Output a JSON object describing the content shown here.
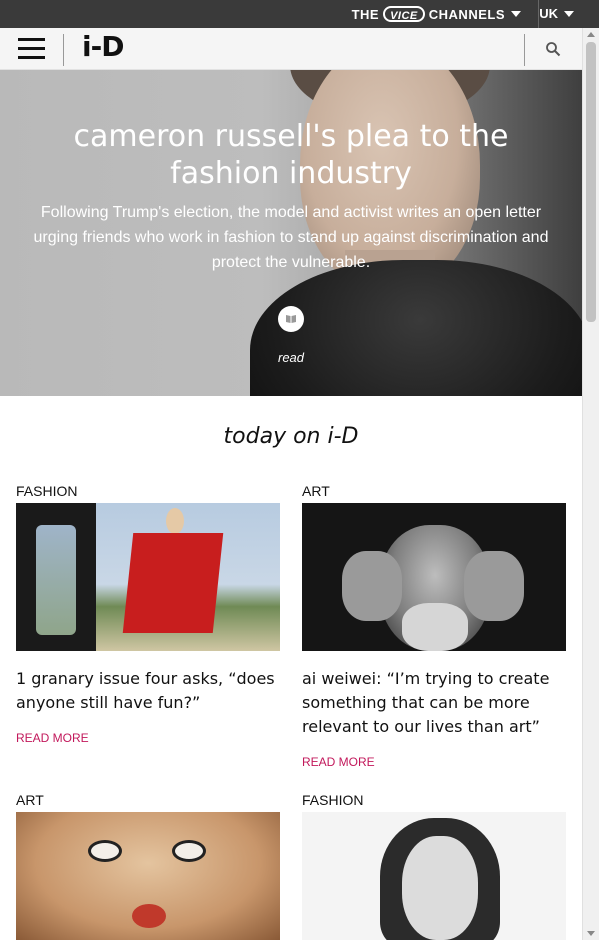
{
  "vice_bar": {
    "prefix": "THE",
    "vice_logo": "VICE",
    "channels_label": "CHANNELS",
    "region": "UK"
  },
  "header": {
    "logo": "i-D"
  },
  "hero": {
    "title": "cameron russell's plea to the fashion industry",
    "summary": "Following Trump's election, the model and activist writes an open letter urging friends who work in fashion to stand up against discrimination and protect the vulnerable.",
    "read_label": "read"
  },
  "section": {
    "title": "today on i-D"
  },
  "cards": [
    {
      "category": "FASHION",
      "headline": "1 granary issue four asks, “does anyone still have fun?”",
      "read_more": "READ MORE"
    },
    {
      "category": "ART",
      "headline": "ai weiwei: “I’m trying to create something that can be more relevant to our lives than art”",
      "read_more": "READ MORE"
    },
    {
      "category": "ART",
      "headline": "",
      "read_more": ""
    },
    {
      "category": "FASHION",
      "headline": "",
      "read_more": ""
    }
  ],
  "colors": {
    "accent": "#c2185b",
    "top_bar": "#3a3a3a"
  }
}
